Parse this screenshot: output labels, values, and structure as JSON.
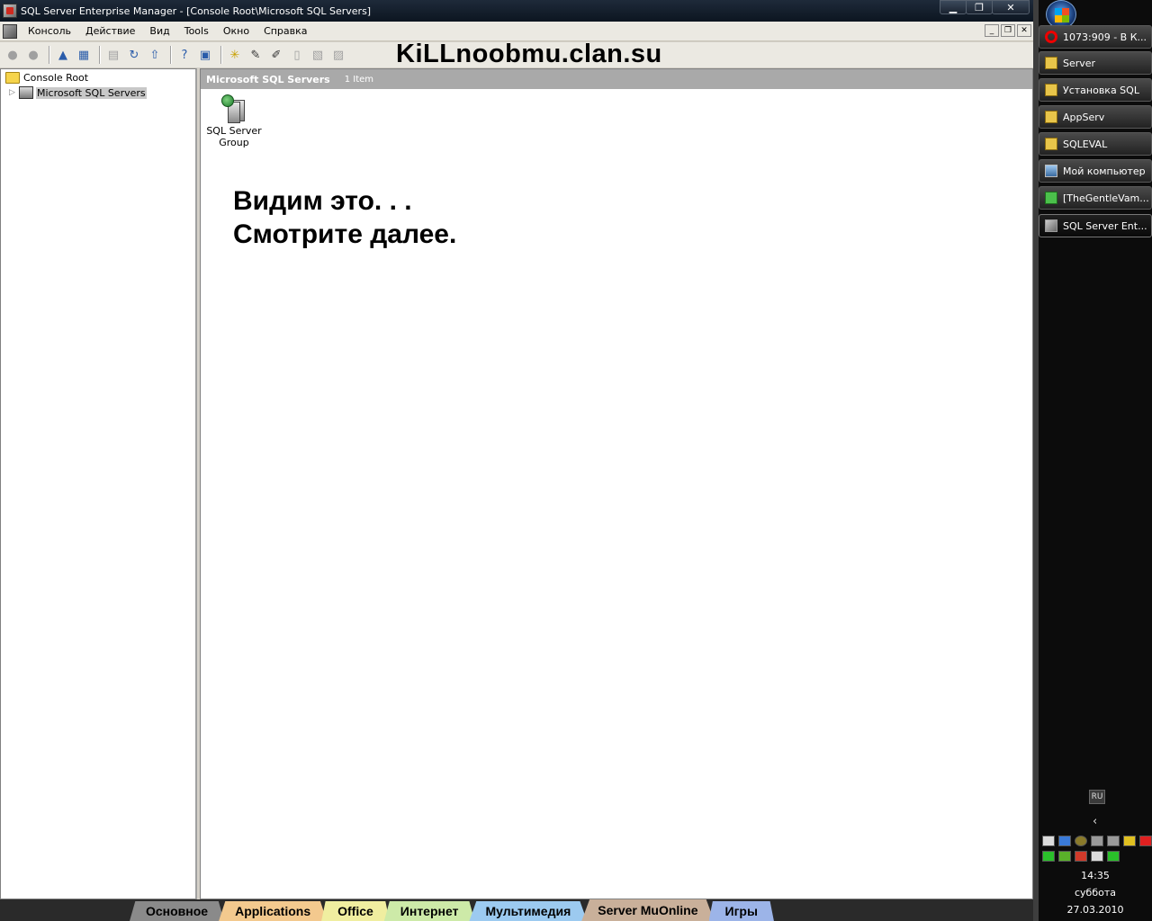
{
  "window": {
    "title": "SQL Server Enterprise Manager - [Console Root\\Microsoft SQL Servers]",
    "minimize": "▁",
    "restore": "❐",
    "close": "✕"
  },
  "menu": [
    "Консоль",
    "Действие",
    "Вид",
    "Tools",
    "Окно",
    "Справка"
  ],
  "watermark": "KiLLnoobmu.clan.su",
  "tree": {
    "root": "Console Root",
    "child": "Microsoft SQL Servers"
  },
  "right_pane": {
    "title": "Microsoft SQL Servers",
    "count": "1 Item",
    "item_line1": "SQL Server",
    "item_line2": "Group"
  },
  "overlay": {
    "line1": "Видим это. . .",
    "line2": "Смотрите далее."
  },
  "bottom_tabs": [
    {
      "label": "Основное",
      "color": "#8a8a8a"
    },
    {
      "label": "Applications",
      "color": "#f3c98e"
    },
    {
      "label": "Office",
      "color": "#f0eea0"
    },
    {
      "label": "Интернет",
      "color": "#cdeaa8"
    },
    {
      "label": "Мультимедия",
      "color": "#9ccaf0"
    },
    {
      "label": "Server MuOnline",
      "color": "#c9b09a"
    },
    {
      "label": "Игры",
      "color": "#9cb4e8"
    }
  ],
  "taskbar": {
    "items": [
      "1073:909 - В К...",
      "Server",
      "Установка SQL",
      "AppServ",
      "SQLEVAL",
      "Мой компьютер",
      "[TheGentleVam...",
      "SQL Server Ent..."
    ],
    "language": "RU",
    "time": "14:35",
    "weekday": "суббота",
    "date": "27.03.2010"
  }
}
